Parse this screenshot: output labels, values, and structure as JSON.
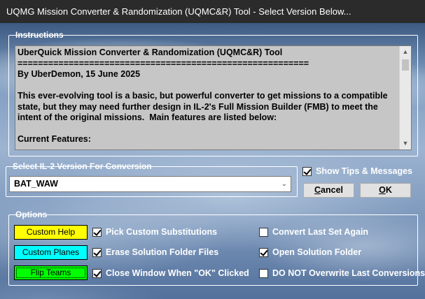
{
  "window": {
    "title": "UQMG Mission Converter & Randomization (UQMC&R) Tool - Select Version Below..."
  },
  "instructions": {
    "legend": "Instructions",
    "text": "UberQuick Mission Converter & Randomization (UQMC&R) Tool\n=========================================================\nBy UberDemon, 15 June 2025\n\nThis ever-evolving tool is a basic, but powerful converter to get missions to a compatible state, but they may need further design in IL-2's Full Mission Builder (FMB) to meet the intent of the original missions.  Main features are listed below:\n\nCurrent Features:\n-----------------"
  },
  "version_select": {
    "legend": "Select IL-2 Version For Conversion",
    "selected": "BAT_WAW"
  },
  "show_tips": {
    "label": "Show Tips & Messages",
    "checked": true
  },
  "buttons": {
    "cancel": {
      "first": "C",
      "rest": "ancel"
    },
    "ok": {
      "first": "O",
      "rest": "K"
    }
  },
  "options": {
    "legend": "Options",
    "color_buttons": [
      {
        "label": "Custom Help",
        "color": "#ffff00"
      },
      {
        "label": "Custom Planes",
        "color": "#00ffff"
      },
      {
        "label": "Flip Teams",
        "color": "#00ff00"
      }
    ],
    "checks_col1": [
      {
        "label": "Pick Custom Substitutions",
        "checked": true
      },
      {
        "label": "Erase Solution Folder Files",
        "checked": true
      },
      {
        "label": "Close Window When \"OK\" Clicked",
        "checked": true
      }
    ],
    "checks_col2": [
      {
        "label": "Convert Last Set Again",
        "checked": false
      },
      {
        "label": "Open Solution Folder",
        "checked": true
      },
      {
        "label": "DO NOT Overwrite Last Conversions",
        "checked": false
      }
    ]
  }
}
